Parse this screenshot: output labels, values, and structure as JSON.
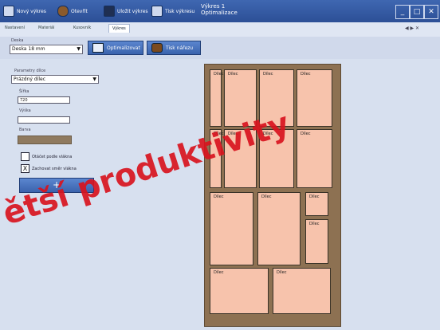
{
  "topbar": {
    "buttons": [
      {
        "label": "Nový výkres",
        "icon": "new-document-icon"
      },
      {
        "label": "Otevřít",
        "icon": "open-folder-icon"
      },
      {
        "label": "Uložit výkres",
        "icon": "save-icon"
      },
      {
        "label": "Tisk výkresu",
        "icon": "print-icon"
      }
    ],
    "title_line1": "Výkres 1",
    "title_line2": "Optimalizace",
    "window_controls": [
      "_",
      "□",
      "✕"
    ]
  },
  "tabs": {
    "items": [
      "Nastavení",
      "Materiál",
      "Kusovník",
      "Výkres"
    ],
    "active_index": 3,
    "arrows": "◀ ▶ ✕"
  },
  "toolbar": {
    "material_label": "Deska",
    "material_value": "Deska 18 mm",
    "optimize_label": "Optimalizovat",
    "print_label": "Tisk nářezu"
  },
  "leftpanel": {
    "group_label": "Parametry dílce",
    "preset_value": "Prázdný dílec",
    "width_label": "Šířka",
    "width_value": "720",
    "height_label": "Výška",
    "height_value": "",
    "color_label": "Barva",
    "color_hex": "#8f7a5f",
    "checkbox1_label": "Otáčet podle vlákna",
    "checkbox1_checked": false,
    "checkbox2_label": "Zachovat směr vlákna",
    "checkbox2_checked": true,
    "add_label": "+"
  },
  "board": {
    "pieces": [
      "Dílec",
      "Dílec",
      "Dílec",
      "Dílec",
      "Dílec",
      "Dílec",
      "Dílec",
      "Dílec",
      "Dílec",
      "Dílec",
      "Dílec",
      "Dílec",
      "Dílec",
      "Dílec"
    ]
  },
  "watermark": {
    "text": "ětší produktivity"
  }
}
